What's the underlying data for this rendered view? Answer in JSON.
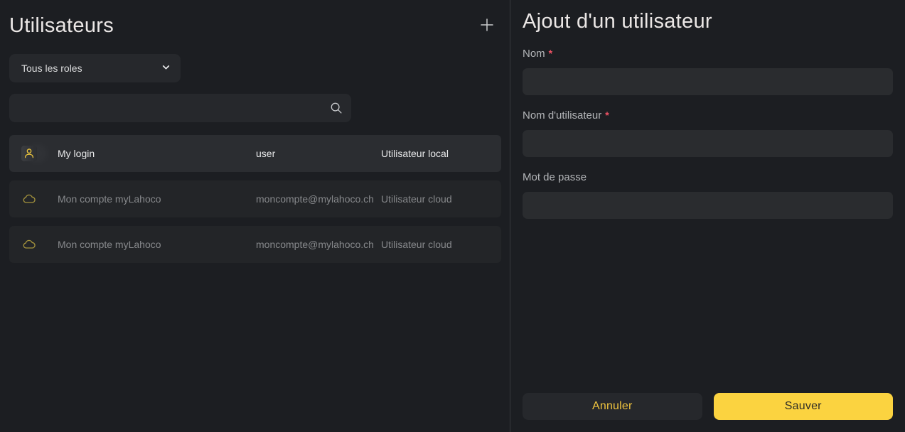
{
  "left_panel": {
    "title": "Utilisateurs",
    "role_filter": {
      "selected": "Tous les roles"
    },
    "search": {
      "placeholder": "",
      "value": ""
    },
    "users": [
      {
        "name": "My login",
        "login": "user",
        "type": "Utilisateur local",
        "icon": "person",
        "selected": true
      },
      {
        "name": "Mon compte myLahoco",
        "login": "moncompte@mylahoco.ch",
        "type": "Utilisateur cloud",
        "icon": "cloud",
        "selected": false
      },
      {
        "name": "Mon compte myLahoco",
        "login": "moncompte@mylahoco.ch",
        "type": "Utilisateur cloud",
        "icon": "cloud",
        "selected": false
      }
    ]
  },
  "right_panel": {
    "title": "Ajout d'un utilisateur",
    "required_mark": "*",
    "fields": [
      {
        "label": "Nom",
        "required": true,
        "value": ""
      },
      {
        "label": "Nom d'utilisateur",
        "required": true,
        "value": ""
      },
      {
        "label": "Mot de passe",
        "required": false,
        "value": ""
      }
    ],
    "buttons": {
      "cancel": "Annuler",
      "save": "Sauver"
    }
  },
  "colors": {
    "background": "#1c1e22",
    "panel_divider": "#37393d",
    "row_background": "#232528",
    "row_selected_background": "#2b2d31",
    "control_background": "#26282c",
    "accent_yellow": "#fbd340",
    "icon_yellow": "#f2ca3d",
    "cloud_icon_olive": "#a3923c",
    "required_red": "#f05365"
  }
}
